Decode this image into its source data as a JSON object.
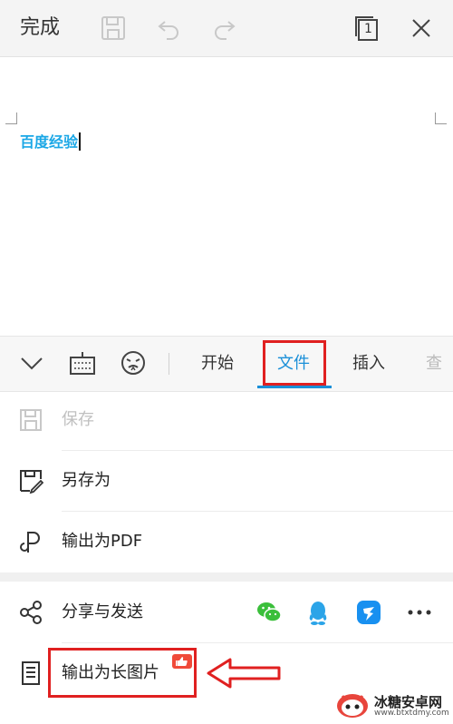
{
  "topbar": {
    "done_label": "完成",
    "icons": [
      "save-icon",
      "undo-icon",
      "redo-icon",
      "page-count-icon",
      "close-icon"
    ],
    "page_count": "1"
  },
  "document": {
    "text": "百度经验"
  },
  "toolbar": {
    "tabs": [
      {
        "label": "开始"
      },
      {
        "label": "文件"
      },
      {
        "label": "插入"
      }
    ],
    "active_tab": "文件",
    "partial_tab": "查"
  },
  "file_menu": {
    "items": [
      {
        "label": "保存",
        "enabled": false
      },
      {
        "label": "另存为",
        "enabled": true
      },
      {
        "label": "输出为PDF",
        "enabled": true
      },
      {
        "label": "分享与发送",
        "enabled": true
      },
      {
        "label": "输出为长图片",
        "enabled": true
      }
    ]
  },
  "share_targets": [
    "wechat-icon",
    "qq-icon",
    "dingtalk-icon",
    "more-icon"
  ],
  "watermark": {
    "name": "冰糖安卓网",
    "url": "www.btxtdmy.com"
  },
  "colors": {
    "accent": "#1a8fd8",
    "highlight_box": "#e02020",
    "doc_text": "#1aa7e6",
    "wechat": "#3bbf3b",
    "qq": "#2ba4e8",
    "dingtalk": "#1890f0"
  }
}
